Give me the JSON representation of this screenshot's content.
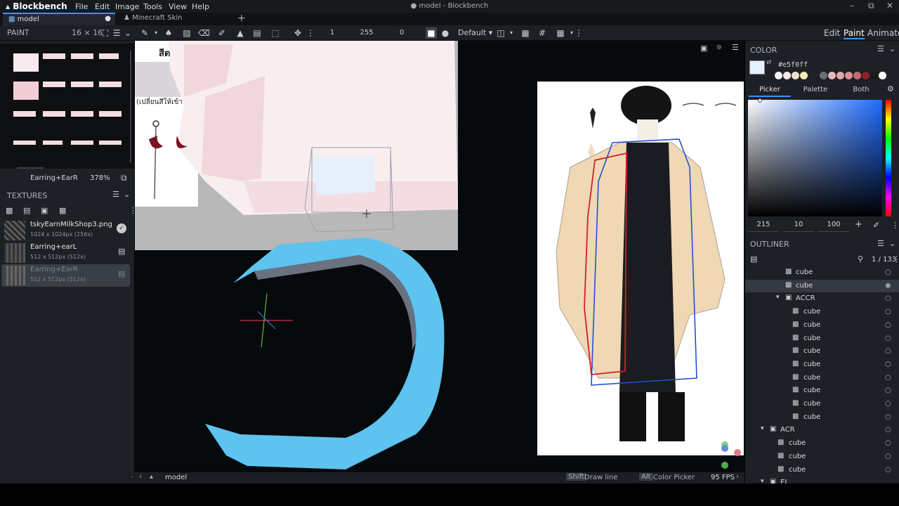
{
  "app": {
    "name": "Blockbench",
    "window_title": "● model - Blockbench",
    "menu": [
      "File",
      "Edit",
      "Image",
      "Tools",
      "View",
      "Help"
    ]
  },
  "tabs": [
    {
      "label": "model",
      "active": true
    },
    {
      "label": "Minecraft Skin",
      "active": false
    }
  ],
  "toolbar": {
    "brush_size": "1",
    "opacity": "255",
    "softness": "0",
    "blend_mode": "Default"
  },
  "modes": [
    "Edit",
    "Paint",
    "Animate"
  ],
  "paint_panel": {
    "title": "PAINT",
    "grid_size": "16 × 16",
    "texture_name": "Earring+EarR",
    "zoom": "378%"
  },
  "textures_panel": {
    "title": "TEXTURES",
    "items": [
      {
        "name": "tskyEarnMilkShop3.png",
        "size": "1024 x 1024px (256x)"
      },
      {
        "name": "Earring+earL",
        "size": "512 x 512px (512x)"
      },
      {
        "name": "Earring+EarR",
        "size": "512 x 512px (512x)"
      }
    ]
  },
  "viewport": {
    "ref_text_1": "สีต",
    "ref_text_2": "(เปลี่ยนสีให้เข้า"
  },
  "color_panel": {
    "title": "COLOR",
    "hex": "#e5f0ff",
    "tabs": [
      "Picker",
      "Palette",
      "Both"
    ],
    "hue": "215",
    "saturation": "10",
    "value": "100",
    "accent": "#3e90ff",
    "palette_colors": [
      "#f3f3f3",
      "#f4e7e7",
      "#f0e1cf",
      "#f7e7b8",
      "#6a6f78",
      "#e6b8bd",
      "#e3a7ad",
      "#d9909a",
      "#c76870",
      "#8f1f2a",
      "#1a1a1a",
      "#ffffff"
    ]
  },
  "outliner": {
    "title": "OUTLINER",
    "count": "1 / 133",
    "items": [
      {
        "label": "cube",
        "type": "cube",
        "indent": 0
      },
      {
        "label": "cube",
        "type": "cube",
        "indent": 0,
        "selected": true
      },
      {
        "label": "ACCR",
        "type": "group",
        "indent": 0
      },
      {
        "label": "cube",
        "type": "cube",
        "indent": 1
      },
      {
        "label": "cube",
        "type": "cube",
        "indent": 1
      },
      {
        "label": "cube",
        "type": "cube",
        "indent": 1
      },
      {
        "label": "cube",
        "type": "cube",
        "indent": 1
      },
      {
        "label": "cube",
        "type": "cube",
        "indent": 1
      },
      {
        "label": "cube",
        "type": "cube",
        "indent": 1
      },
      {
        "label": "cube",
        "type": "cube",
        "indent": 1
      },
      {
        "label": "cube",
        "type": "cube",
        "indent": 1
      },
      {
        "label": "cube",
        "type": "cube",
        "indent": 1
      },
      {
        "label": "ACR",
        "type": "group",
        "indent": -1
      },
      {
        "label": "cube",
        "type": "cube",
        "indent": 0
      },
      {
        "label": "cube",
        "type": "cube",
        "indent": 0
      },
      {
        "label": "cube",
        "type": "cube",
        "indent": 0
      },
      {
        "label": "EL",
        "type": "group",
        "indent": -1
      }
    ]
  },
  "statusbar": {
    "breadcrumb": "model",
    "shift_key": "Shift",
    "shift_action": "Draw line",
    "alt_key": "Alt",
    "alt_action": "Color Picker",
    "fps": "95 FPS"
  }
}
